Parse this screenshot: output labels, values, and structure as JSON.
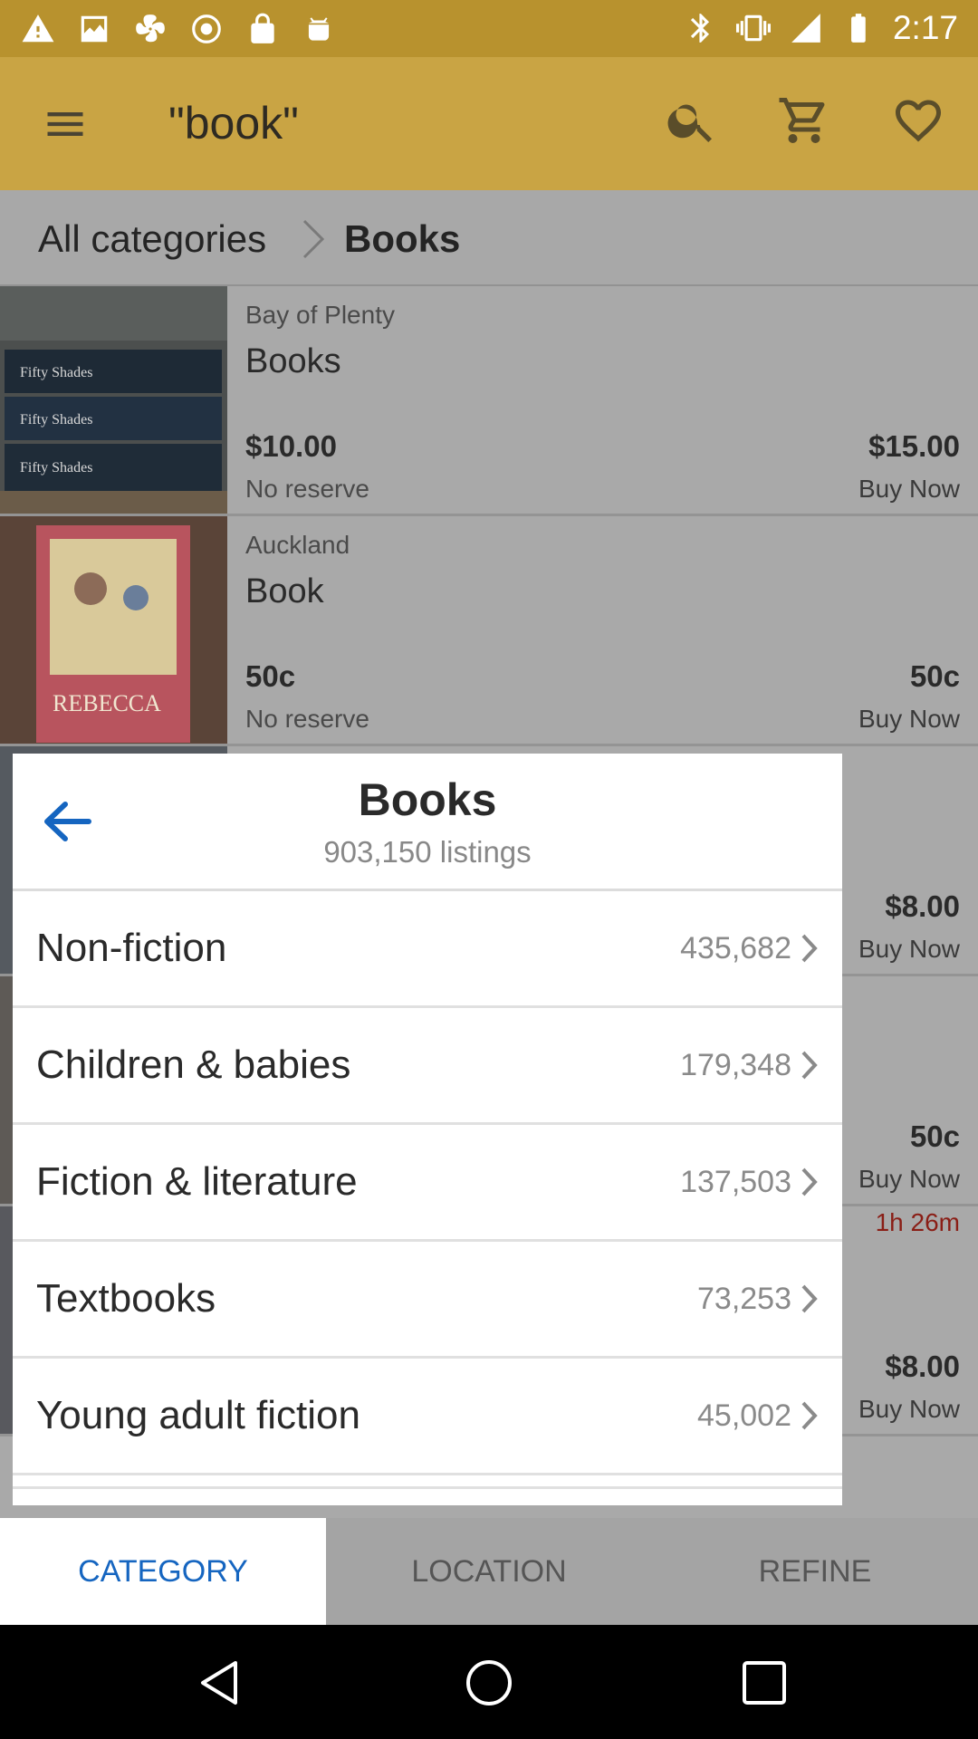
{
  "status_bar": {
    "time": "2:17",
    "left_icons": [
      "warning-icon",
      "image-icon",
      "fan-icon",
      "recording-icon",
      "lock-icon",
      "android-icon"
    ],
    "right_icons": [
      "bluetooth-icon",
      "vibrate-icon",
      "signal-icon",
      "battery-icon"
    ]
  },
  "app_bar": {
    "title": "\"book\"",
    "icons": [
      "menu-icon",
      "search-icon",
      "cart-icon",
      "heart-icon"
    ]
  },
  "breadcrumb": {
    "root": "All categories",
    "current": "Books"
  },
  "listings": [
    {
      "location": "Bay of Plenty",
      "title": "Books",
      "price_left": "$10.00",
      "sub_left": "No reserve",
      "price_right": "$15.00",
      "sub_right": "Buy Now"
    },
    {
      "location": "Auckland",
      "title": "Book",
      "price_left": "50c",
      "sub_left": "No reserve",
      "price_right": "50c",
      "sub_right": "Buy Now"
    },
    {
      "price_right": "$8.00",
      "sub_right": "Buy Now"
    },
    {
      "price_right": "50c",
      "sub_right": "Buy Now",
      "time_left": "1h 26m"
    },
    {
      "price_right": "$8.00",
      "sub_right": "Buy Now"
    }
  ],
  "sheet": {
    "title": "Books",
    "listing_count": "903,150 listings",
    "categories": [
      {
        "label": "Non-fiction",
        "count": "435,682"
      },
      {
        "label": "Children & babies",
        "count": "179,348"
      },
      {
        "label": "Fiction & literature",
        "count": "137,503"
      },
      {
        "label": "Textbooks",
        "count": "73,253"
      },
      {
        "label": "Young adult fiction",
        "count": "45,002"
      }
    ]
  },
  "tabs": {
    "category": "CATEGORY",
    "location": "LOCATION",
    "refine": "REFINE"
  },
  "colors": {
    "accent_blue": "#1565c0",
    "app_bar_yellow": "#fbc84a",
    "time_left_red": "#c0281b"
  }
}
